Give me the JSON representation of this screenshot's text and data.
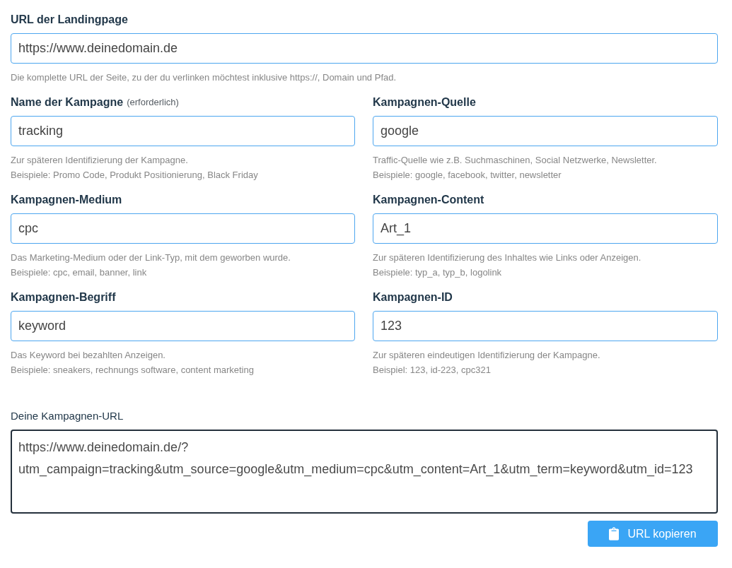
{
  "landing_page": {
    "label": "URL der Landingpage",
    "value": "https://www.deinedomain.de",
    "help": "Die komplette URL der Seite, zu der du verlinken möchtest inklusive https://, Domain und Pfad."
  },
  "fields": [
    {
      "label": "Name der Kampagne",
      "note": "(erforderlich)",
      "value": "tracking",
      "help": [
        "Zur späteren Identifizierung der Kampagne.",
        "Beispiele: Promo Code, Produkt Positionierung, Black Friday"
      ]
    },
    {
      "label": "Kampagnen-Quelle",
      "value": "google",
      "help": [
        "Traffic-Quelle wie z.B. Suchmaschinen, Social Netzwerke, Newsletter.",
        "Beispiele: google, facebook, twitter, newsletter"
      ]
    },
    {
      "label": "Kampagnen-Medium",
      "value": "cpc",
      "help": [
        "Das Marketing-Medium oder der Link-Typ, mit dem geworben wurde.",
        "Beispiele: cpc, email, banner, link"
      ]
    },
    {
      "label": "Kampagnen-Content",
      "value": "Art_1",
      "help": [
        "Zur späteren Identifizierung des Inhaltes wie Links oder Anzeigen.",
        "Beispiele: typ_a, typ_b, logolink"
      ]
    },
    {
      "label": "Kampagnen-Begriff",
      "value": "keyword",
      "help": [
        "Das Keyword bei bezahlten Anzeigen.",
        "Beispiele: sneakers, rechnungs software, content marketing"
      ]
    },
    {
      "label": "Kampagnen-ID",
      "value": "123",
      "help": [
        "Zur späteren eindeutigen Identifizierung der Kampagne.",
        "Beispiel: 123, id-223, cpc321"
      ]
    }
  ],
  "result": {
    "label": "Deine Kampagnen-URL",
    "value": "https://www.deinedomain.de/?utm_campaign=tracking&utm_source=google&utm_medium=cpc&utm_content=Art_1&utm_term=keyword&utm_id=123"
  },
  "copy_button": {
    "label": "URL kopieren"
  }
}
